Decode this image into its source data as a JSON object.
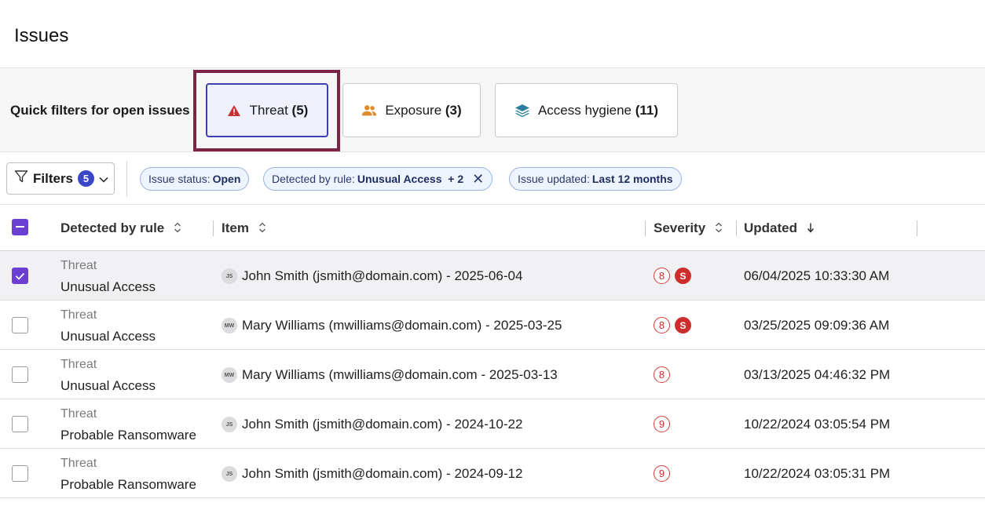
{
  "page": {
    "title": "Issues"
  },
  "quick_filters": {
    "label": "Quick filters for open issues",
    "buttons": [
      {
        "label": "Threat",
        "count": "(5)",
        "icon": "warning-triangle-icon",
        "color": "#c62d2d",
        "active": true
      },
      {
        "label": "Exposure",
        "count": "(3)",
        "icon": "users-icon",
        "color": "#e08a2c",
        "active": false
      },
      {
        "label": "Access hygiene",
        "count": "(11)",
        "icon": "layers-icon",
        "color": "#2d7ea0",
        "active": false
      }
    ]
  },
  "filter_bar": {
    "filters_label": "Filters",
    "filters_count": "5",
    "chips": [
      {
        "key": "Issue status:",
        "value": "Open"
      },
      {
        "key": "Detected by rule:",
        "value": "Unusual Access  + 2",
        "removable": true
      },
      {
        "key": "Issue updated:",
        "value": "Last 12 months"
      }
    ]
  },
  "table": {
    "columns": [
      "Detected by rule",
      "Item",
      "Severity",
      "Updated"
    ],
    "rows": [
      {
        "category": "Threat",
        "rule": "Unusual Access",
        "avatar": "JS",
        "item": "John Smith (jsmith@domain.com) - 2025-06-04",
        "severity": "8",
        "s_badge": "S",
        "updated": "06/04/2025 10:33:30 AM",
        "checked": true
      },
      {
        "category": "Threat",
        "rule": "Unusual Access",
        "avatar": "MW",
        "item": "Mary Williams (mwilliams@domain.com) - 2025-03-25",
        "severity": "8",
        "s_badge": "S",
        "updated": "03/25/2025 09:09:36 AM",
        "checked": false
      },
      {
        "category": "Threat",
        "rule": "Unusual Access",
        "avatar": "MW",
        "item": "Mary Williams (mwilliams@domain.com - 2025-03-13",
        "severity": "8",
        "s_badge": "",
        "updated": "03/13/2025 04:46:32 PM",
        "checked": false
      },
      {
        "category": "Threat",
        "rule": "Probable Ransomware",
        "avatar": "JS",
        "item": "John Smith (jsmith@domain.com) - 2024-10-22",
        "severity": "9",
        "s_badge": "",
        "updated": "10/22/2024 03:05:54 PM",
        "checked": false
      },
      {
        "category": "Threat",
        "rule": "Probable Ransomware",
        "avatar": "JS",
        "item": "John Smith (jsmith@domain.com) - 2024-09-12",
        "severity": "9",
        "s_badge": "",
        "updated": "10/22/2024 03:05:31 PM",
        "checked": false
      }
    ]
  }
}
